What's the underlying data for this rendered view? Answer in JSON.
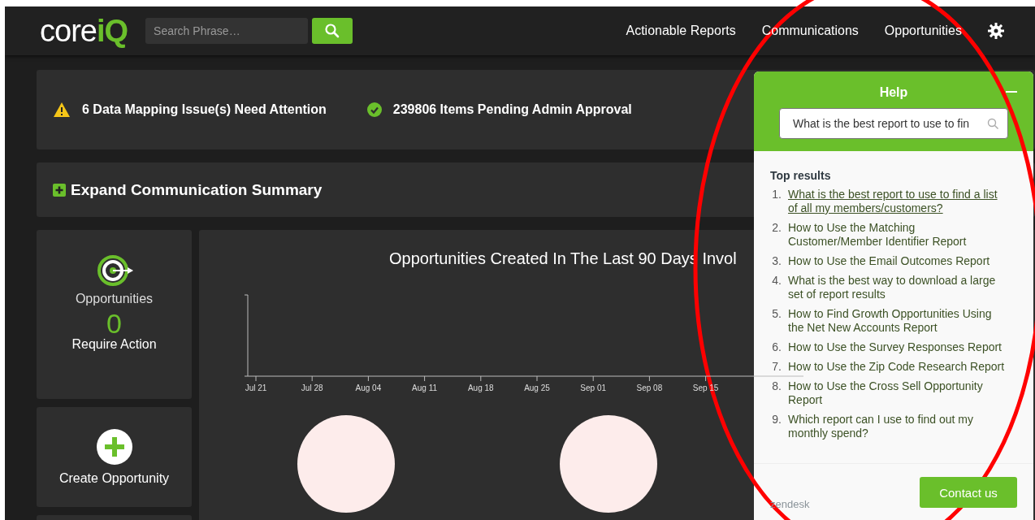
{
  "header": {
    "logo": [
      "core",
      "iQ"
    ],
    "search": {
      "placeholder": "Search Phrase…"
    },
    "nav": [
      {
        "label": "Actionable Reports"
      },
      {
        "label": "Communications"
      },
      {
        "label": "Opportunities"
      }
    ]
  },
  "alerts": [
    {
      "kind": "warning",
      "text": "6 Data Mapping Issue(s) Need Attention"
    },
    {
      "kind": "success",
      "text": "239806 Items Pending Admin Approval"
    }
  ],
  "summary": {
    "label": "Expand Communication Summary"
  },
  "cards": [
    {
      "kind": "stat",
      "title": "Opportunities",
      "count": "0",
      "caption": "Require Action"
    },
    {
      "kind": "action",
      "label": "Create Opportunity"
    }
  ],
  "chart": {
    "title": "Opportunities Created In The Last 90 Days Invol",
    "x_labels": [
      "Jul 21",
      "Jul 28",
      "Aug 04",
      "Aug 11",
      "Aug 18",
      "Aug 25",
      "Sep 01",
      "Sep 08",
      "Sep 15"
    ]
  },
  "help": {
    "title": "Help",
    "search": {
      "value": "What is the best report to use to fin"
    },
    "heading": "Top results",
    "results": [
      {
        "number": "1.",
        "text": "What is the best report to use to find a list of all my members/customers?",
        "selected": true
      },
      {
        "number": "2.",
        "text": "How to Use the Matching Customer/Member Identifier Report",
        "selected": false
      },
      {
        "number": "3.",
        "text": "How to Use the Email Outcomes Report",
        "selected": false
      },
      {
        "number": "4.",
        "text": "What is the best way to download a large set of report results",
        "selected": false
      },
      {
        "number": "5.",
        "text": "How to Find Growth Opportunities Using the Net New Accounts Report",
        "selected": false
      },
      {
        "number": "6.",
        "text": "How to Use the Survey Responses Report",
        "selected": false
      },
      {
        "number": "7.",
        "text": "How to Use the Zip Code Research Report",
        "selected": false
      },
      {
        "number": "8.",
        "text": "How to Use the Cross Sell Opportunity Report",
        "selected": false
      },
      {
        "number": "9.",
        "text": "Which report can I use to find out my monthly spend?",
        "selected": false
      }
    ],
    "brand": "zendesk",
    "contact": "Contact us"
  }
}
